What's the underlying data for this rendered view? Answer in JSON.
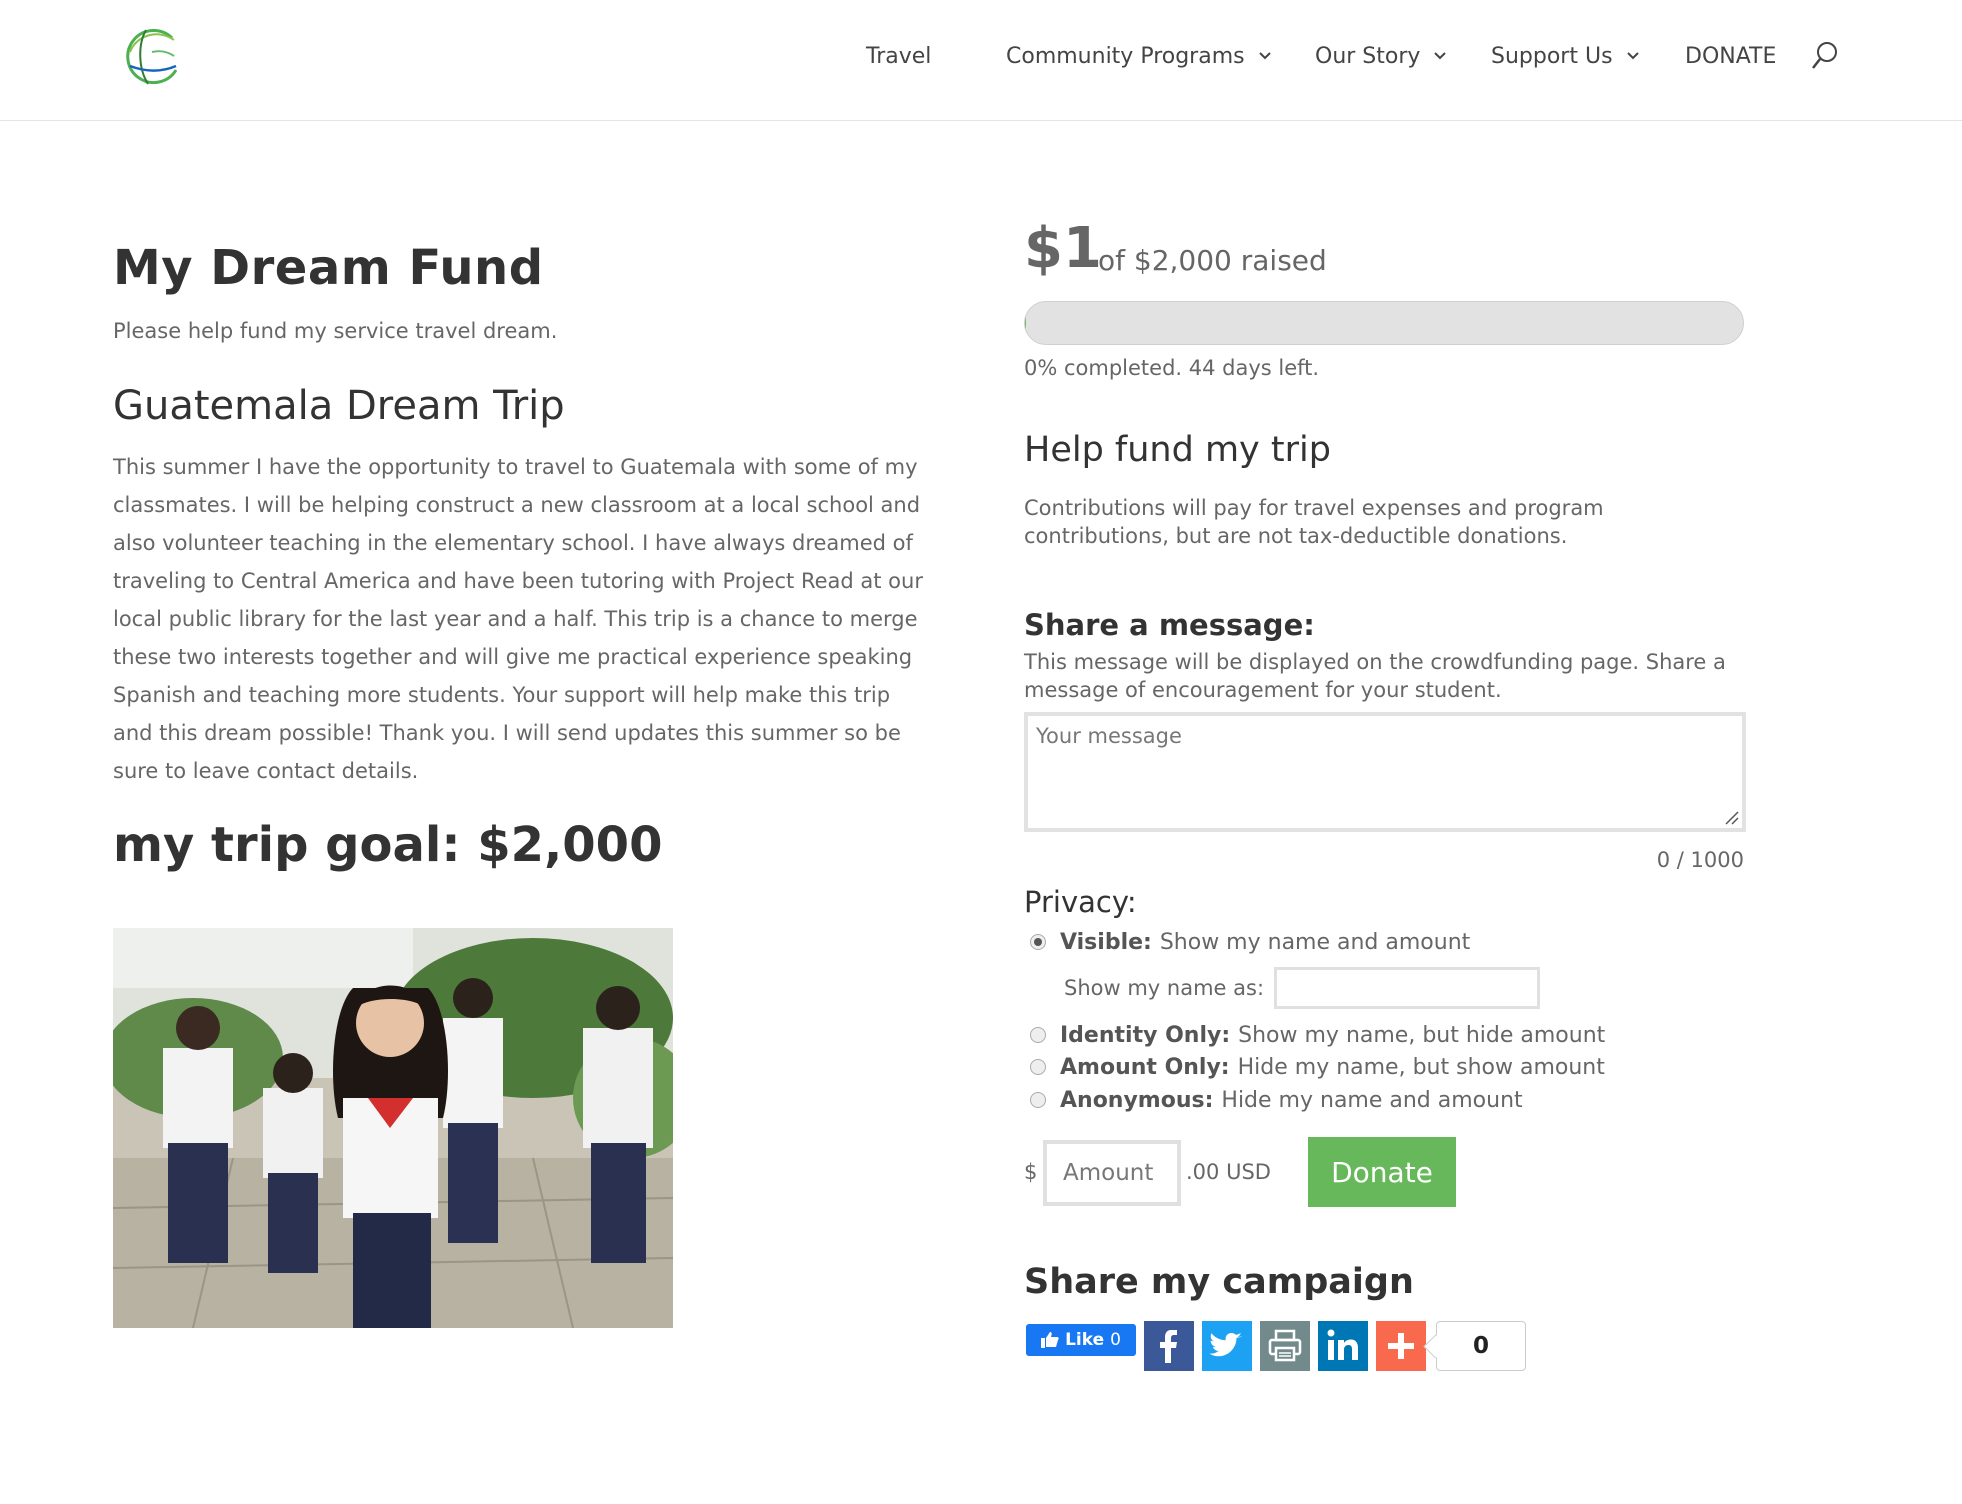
{
  "nav": {
    "items": [
      {
        "label": "Travel"
      },
      {
        "label": "Community Programs"
      },
      {
        "label": "Our Story"
      },
      {
        "label": "Support Us"
      },
      {
        "label": "DONATE"
      }
    ]
  },
  "main": {
    "title": "My Dream Fund",
    "subtitle": "Please help fund my service travel dream.",
    "trip_heading": "Guatemala Dream Trip",
    "body": "This summer I have the opportunity to travel to Guatemala with some of my classmates. I will be helping construct a new classroom at a local school and also volunteer teaching in the elementary school. I have always dreamed of traveling to Central America and have been tutoring with Project Read at our local public library for the last year and a half. This trip is a chance to merge these two interests together and will give me practical experience speaking Spanish and teaching more students. Your support will help make this trip and this dream possible! Thank you. I will send updates this summer so be sure to leave contact details.",
    "goal_heading": "my trip goal: $2,000"
  },
  "sidebar": {
    "raised_amount": "$1",
    "raised_of": "of $2,000 raised",
    "progress_fraction": 0.0005,
    "progress_text": "0% completed. 44 days left.",
    "help_heading": "Help fund my trip",
    "contributions_text": "Contributions will pay for travel expenses and program contributions, but are not tax-deductible donations.",
    "share_message_heading": "Share a message:",
    "share_message_desc": "This message will be displayed on the crowdfunding page. Share a message of encouragement for your student.",
    "message_placeholder": "Your message",
    "message_value": "",
    "message_counter": "0 / 1000",
    "privacy_heading": "Privacy:",
    "privacy_options": [
      {
        "title": "Visible:",
        "desc": "Show my name and amount",
        "selected": true
      },
      {
        "title": "Identity Only:",
        "desc": "Show my name, but hide amount",
        "selected": false
      },
      {
        "title": "Amount Only:",
        "desc": "Hide my name, but show amount",
        "selected": false
      },
      {
        "title": "Anonymous:",
        "desc": "Hide my name and amount",
        "selected": false
      }
    ],
    "show_name_label": "Show my name as:",
    "show_name_value": "",
    "currency_symbol": "$",
    "amount_placeholder": "Amount",
    "amount_suffix": ".00 USD",
    "donate_label": "Donate",
    "share_campaign_heading": "Share my campaign",
    "fb_like_label": "Like",
    "fb_like_count": "0",
    "share_count": "0"
  },
  "icons": {
    "logo": "globe-logo-icon",
    "nav_dropdown": "chevron-down-icon",
    "search": "search-icon",
    "facebook": "facebook-icon",
    "twitter": "twitter-icon",
    "print": "print-icon",
    "linkedin": "linkedin-icon",
    "addthis": "plus-icon"
  },
  "colors": {
    "accent_green": "#66b85a",
    "heading": "#333333",
    "text": "#666666",
    "progress_track": "#e2e2e2",
    "facebook": "#3b5998",
    "twitter": "#1da1f2",
    "print": "#738a8d",
    "linkedin": "#0077b5",
    "addthis": "#f8694d",
    "fb_like": "#1877f2"
  }
}
